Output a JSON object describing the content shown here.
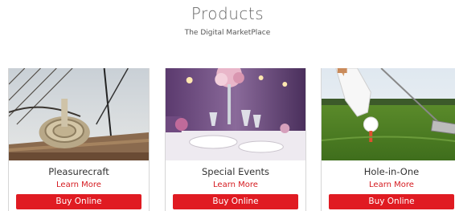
{
  "header": {
    "title": "Products",
    "subtitle": "The Digital MarketPlace"
  },
  "products": [
    {
      "name": "Pleasurecraft",
      "learn_more": "Learn More",
      "buy_label": "Buy Online",
      "image": "sailboat-rope-photo"
    },
    {
      "name": "Special Events",
      "learn_more": "Learn More",
      "buy_label": "Buy Online",
      "image": "banquet-table-photo"
    },
    {
      "name": "Hole-in-One",
      "learn_more": "Learn More",
      "buy_label": "Buy Online",
      "image": "golf-ball-tee-photo"
    }
  ],
  "colors": {
    "accent": "#e01b22",
    "link": "#d51a1f",
    "title": "#666666"
  }
}
